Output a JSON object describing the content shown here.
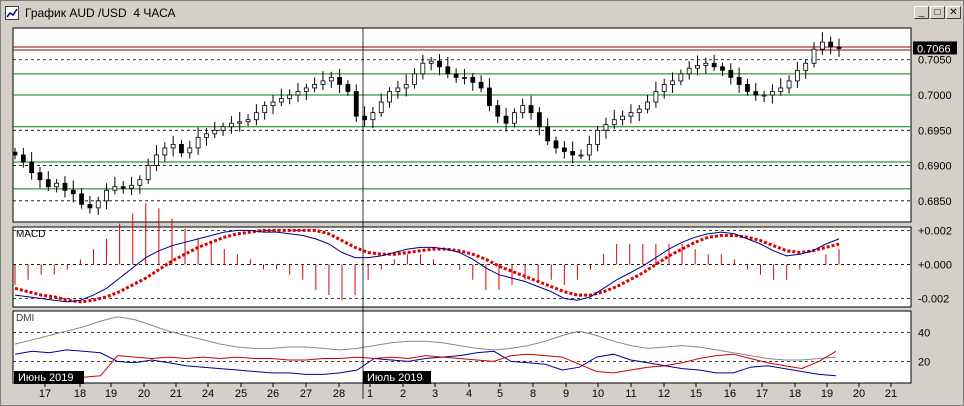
{
  "window": {
    "title": "График AUD /USD  4 ЧАСА",
    "buttons": {
      "minimize": "_",
      "maximize": "□",
      "close": "✕"
    }
  },
  "colors": {
    "background": "#d4d0c8",
    "plot_bg": "#ffffff",
    "resistance_line": "#8b0000",
    "green_levels": "#008000",
    "candles": "#000000",
    "macd_line": "#00008b",
    "macd_signal": "#dd0000",
    "macd_hist": "#dd0000",
    "dmi_plus": "#cc0000",
    "dmi_minus": "#000099",
    "adx": "#888888",
    "month_label_bg": "#000000",
    "month_label_fg": "#ffffff",
    "price_tag_bg": "#000000",
    "price_tag_fg": "#ffffff"
  },
  "chart_data": [
    {
      "type": "candlestick",
      "panel": "price",
      "current_price": "0.7066",
      "y_ticks": [
        "0.7050",
        "0.7000",
        "0.6950",
        "0.6900",
        "0.6850"
      ],
      "ylim": [
        0.682,
        0.7095
      ],
      "horizontal_levels": {
        "red": [
          0.7066
        ],
        "green": [
          0.703,
          0.7,
          0.6955,
          0.6905,
          0.6867
        ]
      },
      "dashed_grid": [
        0.705,
        0.695,
        0.69,
        0.685
      ],
      "date_ticks": [
        "17",
        "18",
        "19",
        "20",
        "21",
        "24",
        "25",
        "26",
        "27",
        "28",
        "1",
        "2",
        "3",
        "4",
        "5",
        "8",
        "9",
        "10",
        "11",
        "12",
        "15",
        "16",
        "17",
        "18",
        "19",
        "20",
        "21"
      ],
      "month_labels": [
        "Июнь 2019",
        "Июль 2019"
      ],
      "close_path": [
        0.6915,
        0.6905,
        0.689,
        0.688,
        0.687,
        0.6875,
        0.6865,
        0.686,
        0.6845,
        0.684,
        0.685,
        0.6865,
        0.687,
        0.6868,
        0.6872,
        0.688,
        0.69,
        0.6915,
        0.6925,
        0.693,
        0.6918,
        0.6925,
        0.694,
        0.6945,
        0.695,
        0.6955,
        0.696,
        0.6962,
        0.6965,
        0.6975,
        0.6985,
        0.699,
        0.6995,
        0.7,
        0.7005,
        0.701,
        0.7015,
        0.702,
        0.7025,
        0.7015,
        0.7005,
        0.697,
        0.6965,
        0.6975,
        0.699,
        0.7005,
        0.701,
        0.7015,
        0.703,
        0.7045,
        0.7048,
        0.704,
        0.703,
        0.7025,
        0.7025,
        0.7018,
        0.701,
        0.6985,
        0.697,
        0.696,
        0.6975,
        0.6985,
        0.6975,
        0.6955,
        0.6935,
        0.6925,
        0.692,
        0.6915,
        0.6915,
        0.693,
        0.695,
        0.6958,
        0.6965,
        0.697,
        0.6975,
        0.698,
        0.699,
        0.7005,
        0.7015,
        0.702,
        0.703,
        0.7038,
        0.7042,
        0.7045,
        0.704,
        0.7035,
        0.7025,
        0.7015,
        0.7005,
        0.7,
        0.7,
        0.7005,
        0.701,
        0.702,
        0.7035,
        0.7045,
        0.7065,
        0.7075,
        0.7068,
        0.7066
      ]
    },
    {
      "type": "line",
      "panel": "macd",
      "title": "MACD",
      "y_ticks": [
        "+0.002",
        "+0.000",
        "-0.002"
      ],
      "ylim": [
        -0.0025,
        0.0022
      ],
      "macd": [
        -0.0018,
        -0.0019,
        -0.002,
        -0.0021,
        -0.0022,
        -0.0021,
        -0.0018,
        -0.0014,
        -0.0008,
        -0.0002,
        0.0004,
        0.0008,
        0.0011,
        0.0013,
        0.0015,
        0.0017,
        0.0019,
        0.002,
        0.002,
        0.0019,
        0.0019,
        0.0018,
        0.0017,
        0.0015,
        0.0012,
        0.0007,
        0.0004,
        0.0004,
        0.0005,
        0.0007,
        0.0009,
        0.001,
        0.001,
        0.0009,
        0.0007,
        0.0003,
        -0.0002,
        -0.0006,
        -0.0008,
        -0.001,
        -0.0013,
        -0.0016,
        -0.002,
        -0.0021,
        -0.0019,
        -0.0014,
        -0.0009,
        -0.0005,
        -0.0001,
        0.0004,
        0.0009,
        0.0013,
        0.0016,
        0.0018,
        0.0019,
        0.0018,
        0.0015,
        0.0012,
        0.0008,
        0.0005,
        0.0006,
        0.0008,
        0.0012,
        0.0015
      ],
      "signal": [
        -0.0014,
        -0.0016,
        -0.0018,
        -0.0019,
        -0.0021,
        -0.0022,
        -0.0021,
        -0.0019,
        -0.0016,
        -0.0012,
        -0.0008,
        -0.0003,
        0.0002,
        0.0006,
        0.001,
        0.0013,
        0.0016,
        0.0018,
        0.0019,
        0.002,
        0.002,
        0.002,
        0.002,
        0.002,
        0.0018,
        0.0014,
        0.001,
        0.0007,
        0.0006,
        0.0006,
        0.0007,
        0.0008,
        0.0009,
        0.0009,
        0.0008,
        0.0006,
        0.0003,
        -0.0001,
        -0.0004,
        -0.0007,
        -0.001,
        -0.0013,
        -0.0016,
        -0.0018,
        -0.0018,
        -0.0016,
        -0.0013,
        -0.0009,
        -0.0005,
        0.0,
        0.0005,
        0.0009,
        0.0013,
        0.0016,
        0.0017,
        0.0017,
        0.0016,
        0.0014,
        0.0011,
        0.0008,
        0.0007,
        0.0008,
        0.001,
        0.0012
      ]
    },
    {
      "type": "line",
      "panel": "dmi",
      "title": "DMI",
      "y_ticks": [
        "40",
        "20"
      ],
      "ylim": [
        5,
        55
      ],
      "adx": [
        32,
        35,
        38,
        41,
        44,
        48,
        51,
        49,
        45,
        41,
        38,
        35,
        32,
        30,
        29,
        29,
        30,
        30,
        29,
        28,
        29,
        31,
        33,
        34,
        34,
        33,
        31,
        29,
        28,
        29,
        31,
        34,
        38,
        41,
        38,
        34,
        31,
        29,
        30,
        31,
        30,
        28,
        26,
        24,
        22,
        21,
        21,
        22,
        23
      ],
      "plus_di": [
        12,
        11,
        10,
        9,
        9,
        10,
        24,
        23,
        22,
        23,
        22,
        23,
        22,
        23,
        22,
        22,
        21,
        21,
        22,
        22,
        23,
        22,
        23,
        22,
        24,
        23,
        22,
        21,
        20,
        24,
        25,
        24,
        23,
        18,
        13,
        12,
        14,
        16,
        17,
        19,
        22,
        24,
        25,
        22,
        19,
        17,
        15,
        20,
        27
      ],
      "minus_di": [
        25,
        27,
        26,
        28,
        27,
        26,
        20,
        19,
        21,
        19,
        17,
        16,
        15,
        14,
        13,
        12,
        12,
        11,
        11,
        12,
        14,
        22,
        21,
        20,
        22,
        23,
        24,
        26,
        27,
        20,
        19,
        18,
        14,
        16,
        23,
        25,
        21,
        19,
        17,
        15,
        14,
        12,
        12,
        16,
        17,
        15,
        13,
        11,
        10
      ]
    }
  ]
}
